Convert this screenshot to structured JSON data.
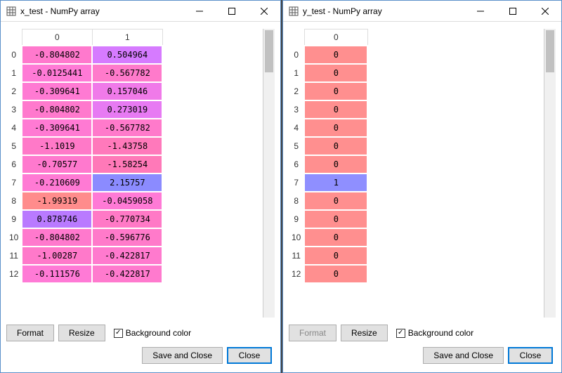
{
  "windows": [
    {
      "title": "x_test - NumPy array",
      "columns": [
        "0",
        "1"
      ],
      "rows": [
        {
          "idx": "0",
          "cells": [
            {
              "v": "-0.804802",
              "bg": "#ff79cd"
            },
            {
              "v": "0.504964",
              "bg": "#d67bff"
            }
          ]
        },
        {
          "idx": "1",
          "cells": [
            {
              "v": "-0.0125441",
              "bg": "#ff7ad6"
            },
            {
              "v": "-0.567782",
              "bg": "#ff7acb"
            }
          ]
        },
        {
          "idx": "2",
          "cells": [
            {
              "v": "-0.309641",
              "bg": "#ff7ad3"
            },
            {
              "v": "0.157046",
              "bg": "#f07ae9"
            }
          ]
        },
        {
          "idx": "3",
          "cells": [
            {
              "v": "-0.804802",
              "bg": "#ff79cd"
            },
            {
              "v": "0.273019",
              "bg": "#e77af3"
            }
          ]
        },
        {
          "idx": "4",
          "cells": [
            {
              "v": "-0.309641",
              "bg": "#ff7ad3"
            },
            {
              "v": "-0.567782",
              "bg": "#ff7acb"
            }
          ]
        },
        {
          "idx": "5",
          "cells": [
            {
              "v": "-1.1019",
              "bg": "#ff79c8"
            },
            {
              "v": "-1.43758",
              "bg": "#ff79bb"
            }
          ]
        },
        {
          "idx": "6",
          "cells": [
            {
              "v": "-0.70577",
              "bg": "#ff79ce"
            },
            {
              "v": "-1.58254",
              "bg": "#ff79b8"
            }
          ]
        },
        {
          "idx": "7",
          "cells": [
            {
              "v": "-0.210609",
              "bg": "#ff7ad4"
            },
            {
              "v": "2.15757",
              "bg": "#8b8bff"
            }
          ]
        },
        {
          "idx": "8",
          "cells": [
            {
              "v": "-1.99319",
              "bg": "#ff8c8c"
            },
            {
              "v": "-0.0459058",
              "bg": "#ff7ad6"
            }
          ]
        },
        {
          "idx": "9",
          "cells": [
            {
              "v": "0.878746",
              "bg": "#b97aff"
            },
            {
              "v": "-0.770734",
              "bg": "#ff79c6"
            }
          ]
        },
        {
          "idx": "10",
          "cells": [
            {
              "v": "-0.804802",
              "bg": "#ff79cd"
            },
            {
              "v": "-0.596776",
              "bg": "#ff7aca"
            }
          ]
        },
        {
          "idx": "11",
          "cells": [
            {
              "v": "-1.00287",
              "bg": "#ff79ca"
            },
            {
              "v": "-0.422817",
              "bg": "#ff7ace"
            }
          ]
        },
        {
          "idx": "12",
          "cells": [
            {
              "v": "-0.111576",
              "bg": "#ff7ad6"
            },
            {
              "v": "-0.422817",
              "bg": "#ff7ace"
            }
          ]
        }
      ],
      "format_enabled": true
    },
    {
      "title": "y_test - NumPy array",
      "columns": [
        "0"
      ],
      "rows": [
        {
          "idx": "0",
          "cells": [
            {
              "v": "0",
              "bg": "#ff8f8f"
            }
          ]
        },
        {
          "idx": "1",
          "cells": [
            {
              "v": "0",
              "bg": "#ff8f8f"
            }
          ]
        },
        {
          "idx": "2",
          "cells": [
            {
              "v": "0",
              "bg": "#ff8f8f"
            }
          ]
        },
        {
          "idx": "3",
          "cells": [
            {
              "v": "0",
              "bg": "#ff8f8f"
            }
          ]
        },
        {
          "idx": "4",
          "cells": [
            {
              "v": "0",
              "bg": "#ff8f8f"
            }
          ]
        },
        {
          "idx": "5",
          "cells": [
            {
              "v": "0",
              "bg": "#ff8f8f"
            }
          ]
        },
        {
          "idx": "6",
          "cells": [
            {
              "v": "0",
              "bg": "#ff8f8f"
            }
          ]
        },
        {
          "idx": "7",
          "cells": [
            {
              "v": "1",
              "bg": "#8f8fff"
            }
          ]
        },
        {
          "idx": "8",
          "cells": [
            {
              "v": "0",
              "bg": "#ff8f8f"
            }
          ]
        },
        {
          "idx": "9",
          "cells": [
            {
              "v": "0",
              "bg": "#ff8f8f"
            }
          ]
        },
        {
          "idx": "10",
          "cells": [
            {
              "v": "0",
              "bg": "#ff8f8f"
            }
          ]
        },
        {
          "idx": "11",
          "cells": [
            {
              "v": "0",
              "bg": "#ff8f8f"
            }
          ]
        },
        {
          "idx": "12",
          "cells": [
            {
              "v": "0",
              "bg": "#ff8f8f"
            }
          ]
        }
      ],
      "format_enabled": false
    }
  ],
  "buttons": {
    "format": "Format",
    "resize": "Resize",
    "save_close": "Save and Close",
    "close": "Close"
  },
  "labels": {
    "bg_color": "Background color"
  },
  "checkbox_checked": "✓"
}
